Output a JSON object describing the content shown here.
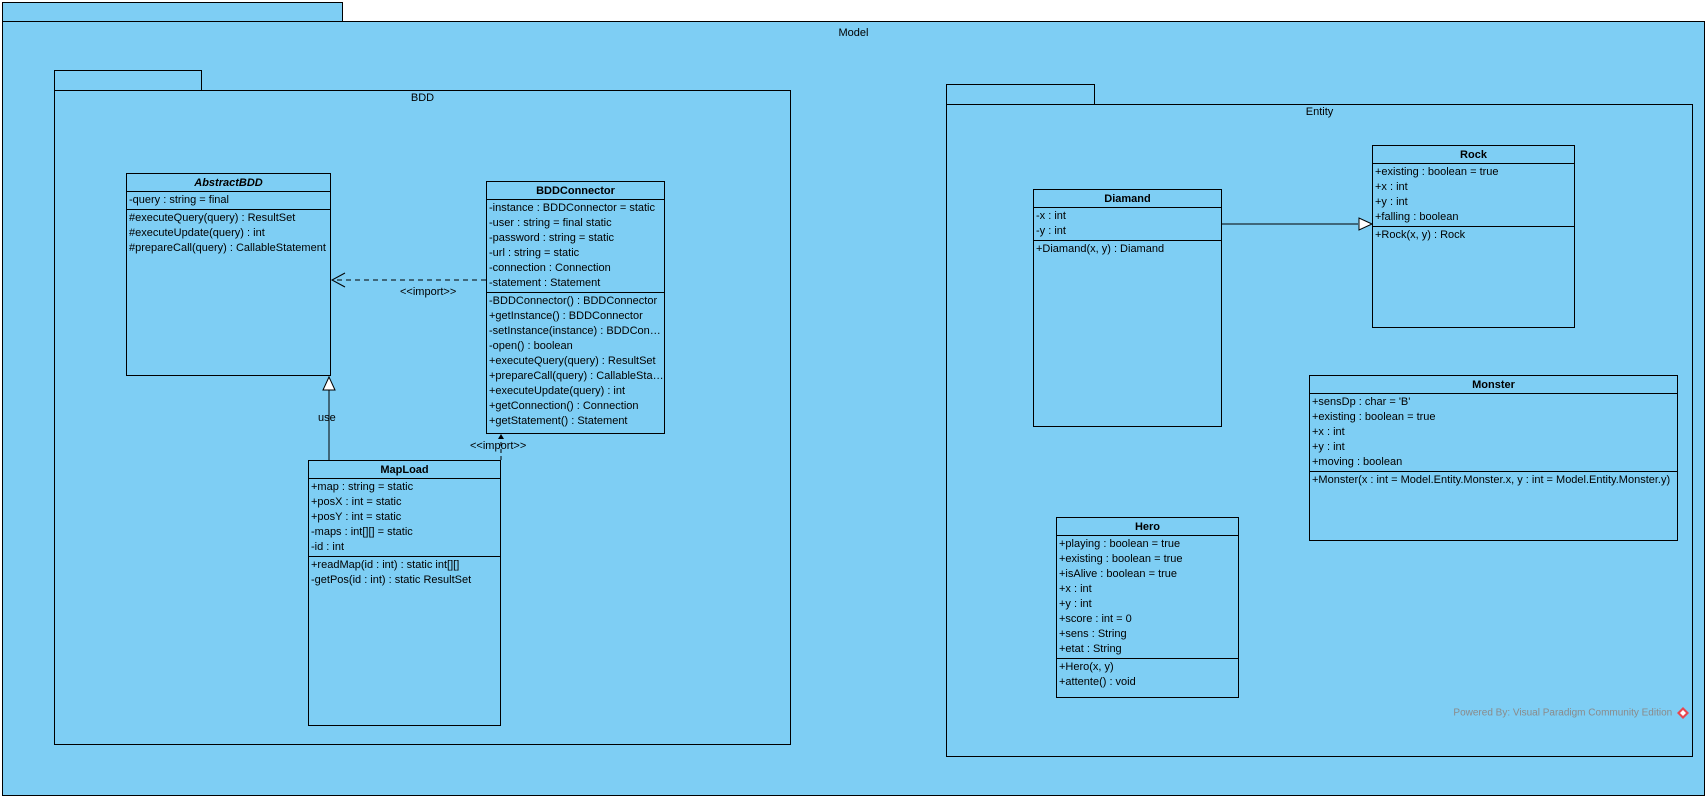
{
  "packages": {
    "model": {
      "name": "Model"
    },
    "bdd": {
      "name": "BDD"
    },
    "entity": {
      "name": "Entity"
    }
  },
  "classes": {
    "abstractbdd": {
      "name": "AbstractBDD",
      "attributes": [
        "-query : string = final"
      ],
      "operations": [
        "#executeQuery(query) : ResultSet",
        "#executeUpdate(query) : int",
        "#prepareCall(query) : CallableStatement"
      ]
    },
    "bddconnector": {
      "name": "BDDConnector",
      "attributes": [
        "-instance : BDDConnector = static",
        "-user : string = final static",
        "-password : string = static",
        "-url : string = static",
        "-connection : Connection",
        "-statement : Statement"
      ],
      "operations": [
        "-BDDConnector() : BDDConnector",
        "+getInstance() : BDDConnector",
        "-setInstance(instance) : BDDConn...",
        "-open() : boolean",
        "+executeQuery(query) : ResultSet",
        "+prepareCall(query) : CallableStat...",
        "+executeUpdate(query) : int",
        "+getConnection() : Connection",
        "+getStatement() : Statement"
      ]
    },
    "mapload": {
      "name": "MapLoad",
      "attributes": [
        "+map : string = static",
        "+posX : int = static",
        "+posY : int = static",
        "-maps : int[][] = static",
        "-id : int"
      ],
      "operations": [
        "+readMap(id : int) : static int[][]",
        "-getPos(id : int) : static ResultSet"
      ]
    },
    "diamand": {
      "name": "Diamand",
      "attributes": [
        "-x : int",
        "-y : int"
      ],
      "operations": [
        "+Diamand(x, y) : Diamand"
      ]
    },
    "rock": {
      "name": "Rock",
      "attributes": [
        "+existing : boolean = true",
        "+x : int",
        "+y : int",
        "+falling : boolean"
      ],
      "operations": [
        "+Rock(x, y) : Rock"
      ]
    },
    "monster": {
      "name": "Monster",
      "attributes": [
        "+sensDp : char = 'B'",
        "+existing : boolean = true",
        "+x : int",
        "+y : int",
        "+moving : boolean"
      ],
      "operations": [
        "+Monster(x : int = Model.Entity.Monster.x, y : int = Model.Entity.Monster.y)"
      ]
    },
    "hero": {
      "name": "Hero",
      "attributes": [
        "+playing : boolean = true",
        "+existing : boolean = true",
        "+isAlive : boolean = true",
        "+x : int",
        "+y : int",
        "+score : int = 0",
        "+sens : String",
        "+etat : String"
      ],
      "operations": [
        "+Hero(x, y)",
        "+attente() : void"
      ]
    }
  },
  "relations": {
    "import1": "<<import>>",
    "import2": "<<import>>",
    "use": "use"
  },
  "watermark": "Powered By: Visual Paradigm Community Edition",
  "colors": {
    "fill": "#7ecef4",
    "line": "#000000",
    "watermark": "#8a8a8a",
    "logo": "#e8474f"
  }
}
